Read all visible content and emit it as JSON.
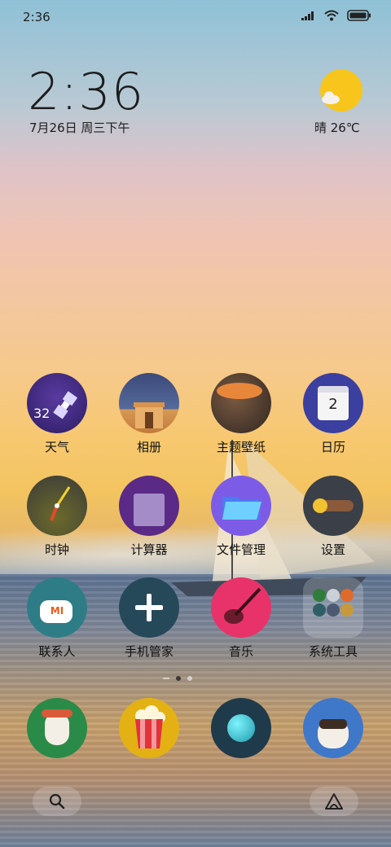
{
  "status_bar": {
    "time": "2:36"
  },
  "clock_widget": {
    "time": "2:36",
    "date": "7月26日 周三下午"
  },
  "weather_widget": {
    "text": "晴 26℃",
    "icon": "sunny-cloud-icon"
  },
  "apps": {
    "row1": [
      {
        "label": "天气",
        "icon": "weather-satellite-icon",
        "badge_text": "32"
      },
      {
        "label": "相册",
        "icon": "gallery-gate-icon"
      },
      {
        "label": "主题壁纸",
        "icon": "theme-planet-icon"
      },
      {
        "label": "日历",
        "icon": "calendar-icon",
        "day": "2"
      }
    ],
    "row2": [
      {
        "label": "时钟",
        "icon": "clock-icon"
      },
      {
        "label": "计算器",
        "icon": "calculator-icon"
      },
      {
        "label": "文件管理",
        "icon": "folder-icon"
      },
      {
        "label": "设置",
        "icon": "settings-toggle-icon"
      }
    ],
    "row3": [
      {
        "label": "联系人",
        "icon": "contacts-mi-icon",
        "logo": "MI"
      },
      {
        "label": "手机管家",
        "icon": "security-plus-icon"
      },
      {
        "label": "音乐",
        "icon": "music-guitar-icon"
      },
      {
        "label": "系统工具",
        "icon": "system-tools-folder-icon"
      }
    ]
  },
  "dock": [
    {
      "icon": "mascot-popcorn-icon"
    },
    {
      "icon": "popcorn-bucket-icon"
    },
    {
      "icon": "browser-orb-icon"
    },
    {
      "icon": "mascot-vr-icon"
    }
  ],
  "page_indicator": {
    "pages": 3,
    "current": 2
  },
  "colors": {
    "calendar_blue": "#3b3fa0",
    "music_pink": "#e8336a",
    "folder_blue": "#4a7cf2"
  }
}
